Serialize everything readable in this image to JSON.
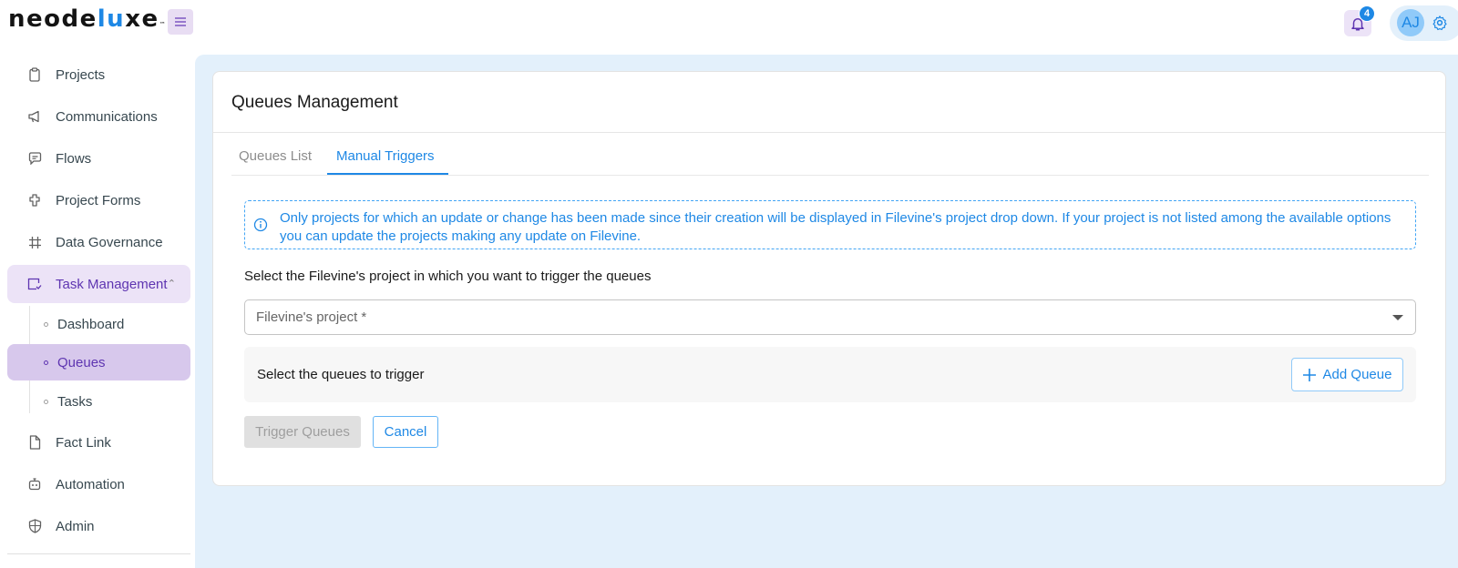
{
  "brand": {
    "logo_prefix": "neode",
    "logo_accent": "lu",
    "logo_suffix": "xe",
    "logo_tm": "™"
  },
  "header": {
    "notification_count": "4",
    "user_initials": "AJ"
  },
  "sidebar": {
    "items": [
      {
        "label": "Projects",
        "icon": "clipboard-icon"
      },
      {
        "label": "Communications",
        "icon": "megaphone-icon"
      },
      {
        "label": "Flows",
        "icon": "chat-icon"
      },
      {
        "label": "Project Forms",
        "icon": "puzzle-icon"
      },
      {
        "label": "Data Governance",
        "icon": "grid-icon"
      },
      {
        "label": "Task Management",
        "icon": "task-icon",
        "expanded": true
      },
      {
        "label": "Fact Link",
        "icon": "file-icon"
      },
      {
        "label": "Automation",
        "icon": "robot-icon"
      },
      {
        "label": "Admin",
        "icon": "shield-icon"
      }
    ],
    "task_submenu": [
      {
        "label": "Dashboard"
      },
      {
        "label": "Queues",
        "active": true
      },
      {
        "label": "Tasks"
      }
    ]
  },
  "main": {
    "title": "Queues Management",
    "tabs": [
      {
        "label": "Queues List"
      },
      {
        "label": "Manual Triggers",
        "active": true
      }
    ],
    "info_text": "Only projects for which an update or change has been made since their creation will be displayed in Filevine's project drop down. If your project is not listed among the available options you can update the projects making any update on Filevine.",
    "select_label": "Select the Filevine's project in which you want to trigger the queues",
    "project_placeholder": "Filevine's project *",
    "queues_label": "Select the queues to trigger",
    "add_queue_label": "Add Queue",
    "trigger_label": "Trigger Queues",
    "cancel_label": "Cancel"
  },
  "colors": {
    "accent": "#1e88e5",
    "purple": "#5e35b1",
    "main_bg": "#e3f0fb"
  }
}
